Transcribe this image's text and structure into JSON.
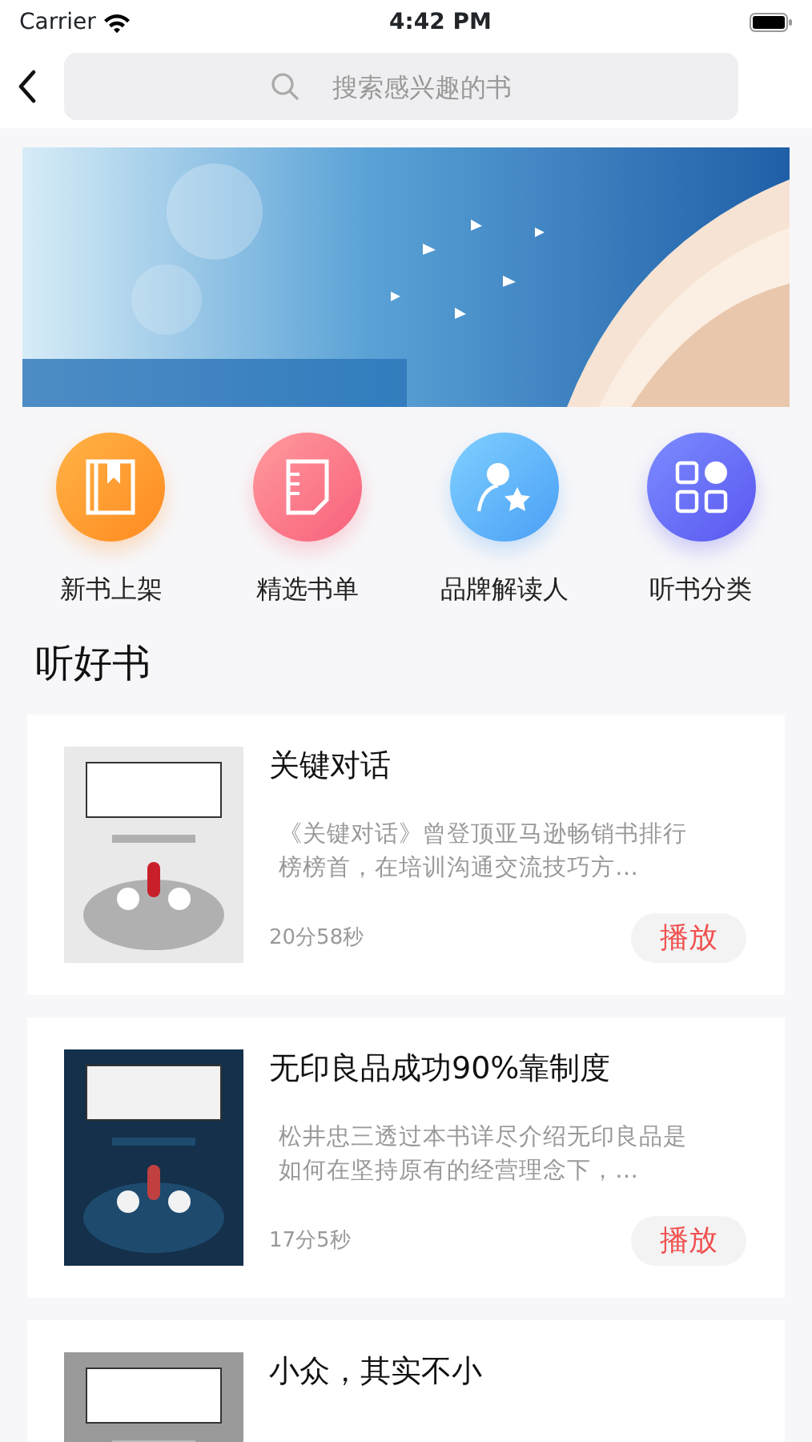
{
  "status_bar": {
    "carrier": "Carrier",
    "time": "4:42 PM"
  },
  "search": {
    "placeholder": "搜索感兴趣的书"
  },
  "categories": [
    {
      "label": "新书上架"
    },
    {
      "label": "精选书单"
    },
    {
      "label": "品牌解读人"
    },
    {
      "label": "听书分类"
    }
  ],
  "section_title": "听好书",
  "books": [
    {
      "title": "关键对话",
      "description": "《关键对话》曾登顶亚马逊畅销书排行榜榜首，在培训沟通交流技巧方…",
      "duration": "20分58秒",
      "play": "播放"
    },
    {
      "title": "无印良品成功90%靠制度",
      "description": "松井忠三透过本书详尽介绍无印良品是如何在坚持原有的经营理念下，…",
      "duration": "17分5秒",
      "play": "播放"
    },
    {
      "title": "小众，其实不小"
    }
  ]
}
